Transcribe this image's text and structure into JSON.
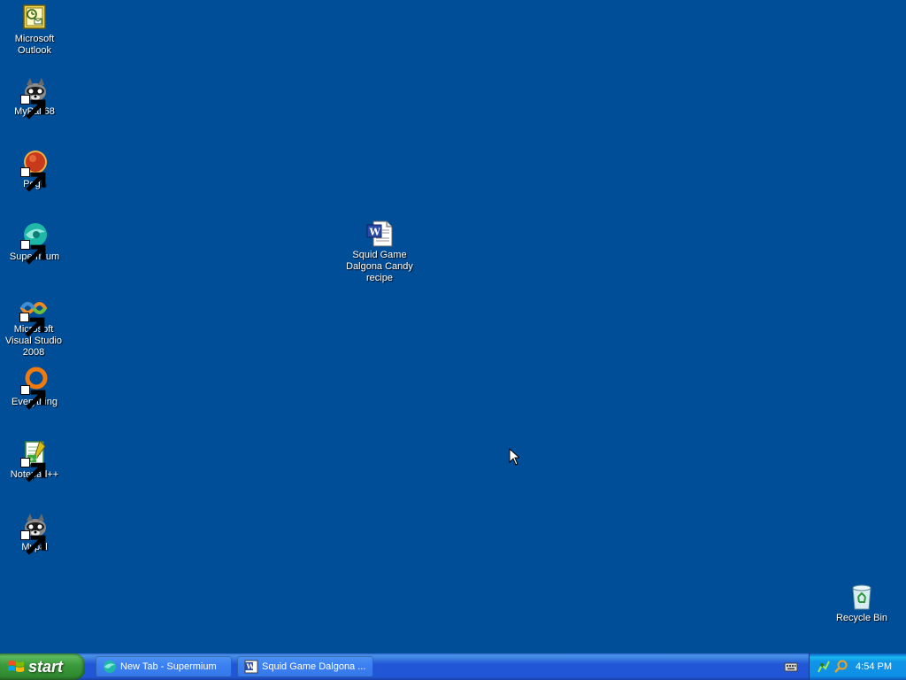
{
  "desktop": {
    "background_color": "#004e98",
    "icons": [
      {
        "label": "Microsoft Outlook",
        "icon": "outlook-icon"
      },
      {
        "label": "MyPal 68",
        "icon": "mypal-icon"
      },
      {
        "label": "Pego",
        "icon": "pego-icon"
      },
      {
        "label": "Supermium",
        "icon": "supermium-icon"
      },
      {
        "label": "Microsoft Visual Studio 2008",
        "icon": "visual-studio-icon"
      },
      {
        "label": "Everything",
        "icon": "everything-icon"
      },
      {
        "label": "Notepad++",
        "icon": "notepadpp-icon"
      },
      {
        "label": "Mypal",
        "icon": "mypal-icon"
      },
      {
        "label": "Squid Game Dalgona Candy recipe",
        "icon": "word-document-icon"
      },
      {
        "label": "Recycle Bin",
        "icon": "recycle-bin-icon"
      }
    ]
  },
  "taskbar": {
    "start_label": "start",
    "tasks": [
      {
        "label": "New Tab - Supermium",
        "icon": "supermium-icon"
      },
      {
        "label": "Squid Game Dalgona ...",
        "icon": "word-icon"
      }
    ],
    "tray": {
      "clock": "4:54 PM",
      "icons": [
        "network-icon",
        "search-icon"
      ]
    },
    "keyboard_icon": "keyboard-icon"
  }
}
